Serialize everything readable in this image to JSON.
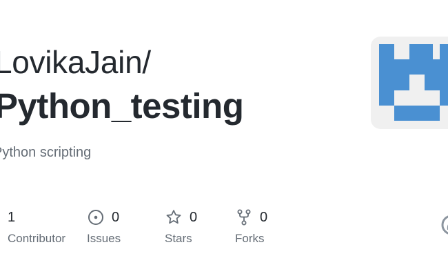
{
  "repo": {
    "owner": "LovikaJain/",
    "name": "Python_testing",
    "description": "Python scripting"
  },
  "stats": {
    "contributors": {
      "value": "1",
      "label": "Contributor"
    },
    "issues": {
      "value": "0",
      "label": "Issues",
      "icon": "issue-opened-icon"
    },
    "stars": {
      "value": "0",
      "label": "Stars",
      "icon": "star-icon"
    },
    "forks": {
      "value": "0",
      "label": "Forks",
      "icon": "repo-forked-icon"
    }
  },
  "colors": {
    "avatar_blue": "#4a90d2",
    "avatar_bg": "#f0f0f0",
    "text_primary": "#24292f",
    "text_muted": "#656d76"
  }
}
